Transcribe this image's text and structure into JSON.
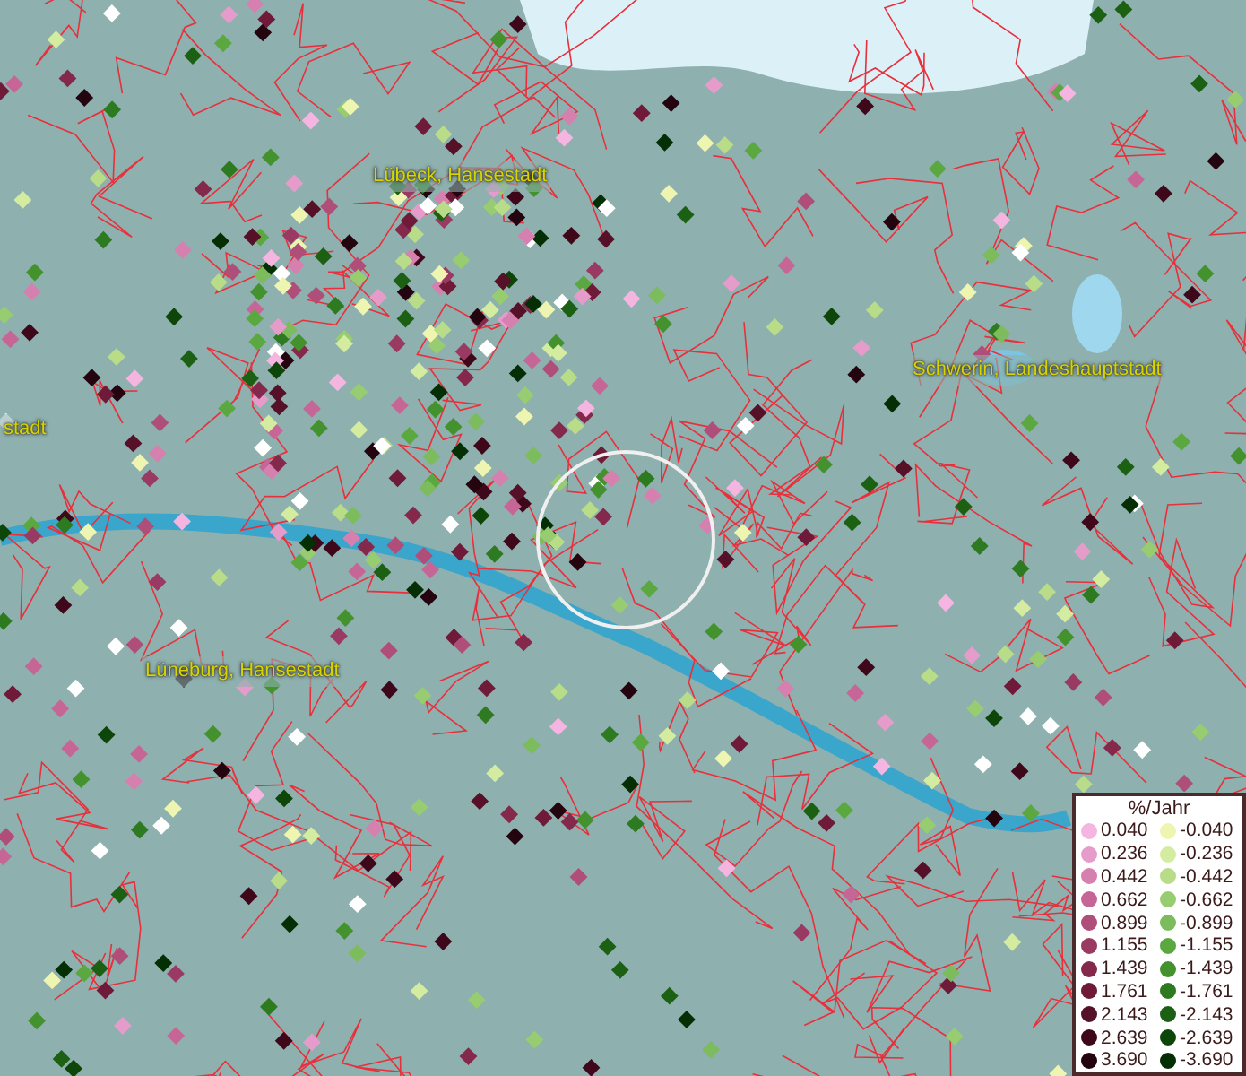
{
  "place_labels": [
    {
      "text": "Lübeck, Hansestadt"
    },
    {
      "text": "Schwerin, Landeshauptstadt"
    },
    {
      "text": "stadt"
    },
    {
      "text": "Lüneburg, Hansestadt"
    }
  ],
  "legend": {
    "title": "%/Jahr",
    "rows": [
      {
        "positive": {
          "value": "0.040",
          "color": "#f4b6e0"
        },
        "negative": {
          "value": "-0.040",
          "color": "#eef5b0"
        }
      },
      {
        "positive": {
          "value": "0.236",
          "color": "#e69ccb"
        },
        "negative": {
          "value": "-0.236",
          "color": "#d4eca0"
        }
      },
      {
        "positive": {
          "value": "0.442",
          "color": "#d680b0"
        },
        "negative": {
          "value": "-0.442",
          "color": "#b8dc88"
        }
      },
      {
        "positive": {
          "value": "0.662",
          "color": "#c66696"
        },
        "negative": {
          "value": "-0.662",
          "color": "#98cc70"
        }
      },
      {
        "positive": {
          "value": "0.899",
          "color": "#b04e7a"
        },
        "negative": {
          "value": "-0.899",
          "color": "#7cbc5c"
        }
      },
      {
        "positive": {
          "value": "1.155",
          "color": "#9a3a62"
        },
        "negative": {
          "value": "-1.155",
          "color": "#5ca840"
        }
      },
      {
        "positive": {
          "value": "1.439",
          "color": "#84284c"
        },
        "negative": {
          "value": "-1.439",
          "color": "#44922e"
        }
      },
      {
        "positive": {
          "value": "1.761",
          "color": "#6e1a38"
        },
        "negative": {
          "value": "-1.761",
          "color": "#2e7a20"
        }
      },
      {
        "positive": {
          "value": "2.143",
          "color": "#561028"
        },
        "negative": {
          "value": "-2.143",
          "color": "#1c6014"
        }
      },
      {
        "positive": {
          "value": "2.639",
          "color": "#3e081a"
        },
        "negative": {
          "value": "-2.639",
          "color": "#0e460a"
        }
      },
      {
        "positive": {
          "value": "3.690",
          "color": "#24040e"
        },
        "negative": {
          "value": "-3.690",
          "color": "#042e04"
        }
      }
    ]
  }
}
